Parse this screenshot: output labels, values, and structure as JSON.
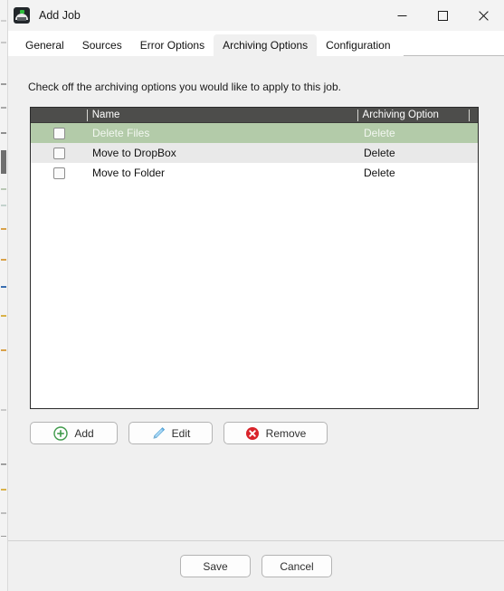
{
  "window": {
    "title": "Add Job",
    "icon": "app-archiver-icon",
    "controls": {
      "minimize": "minimize-icon",
      "maximize": "maximize-icon",
      "close": "close-icon"
    }
  },
  "tabs": [
    {
      "label": "General",
      "selected": false
    },
    {
      "label": "Sources",
      "selected": false
    },
    {
      "label": "Error Options",
      "selected": false
    },
    {
      "label": "Archiving Options",
      "selected": true
    },
    {
      "label": "Configuration",
      "selected": false
    }
  ],
  "page": {
    "instruction": "Check off the archiving options you would like to apply to this job."
  },
  "list": {
    "columns": [
      "",
      "Name",
      "Archiving Option",
      ""
    ],
    "rows": [
      {
        "checked": false,
        "name": "Delete Files",
        "option": "Delete",
        "selected": true
      },
      {
        "checked": false,
        "name": "Move to DropBox",
        "option": "Delete",
        "selected": false
      },
      {
        "checked": false,
        "name": "Move to Folder",
        "option": "Delete",
        "selected": false
      }
    ]
  },
  "actions": {
    "add": {
      "label": "Add",
      "icon": "plus-circle-icon"
    },
    "edit": {
      "label": "Edit",
      "icon": "pencil-icon"
    },
    "remove": {
      "label": "Remove",
      "icon": "x-circle-icon"
    }
  },
  "footer": {
    "save": "Save",
    "cancel": "Cancel"
  },
  "colors": {
    "selected_row": "#b3cba9",
    "header_bar": "#4d4d4b",
    "alt_row": "#e9e9e9",
    "add_icon": "#3f9a4a",
    "edit_icon": "#5aa9e0",
    "remove_icon": "#d9232a",
    "dialog_bg": "#f0f0f0"
  }
}
